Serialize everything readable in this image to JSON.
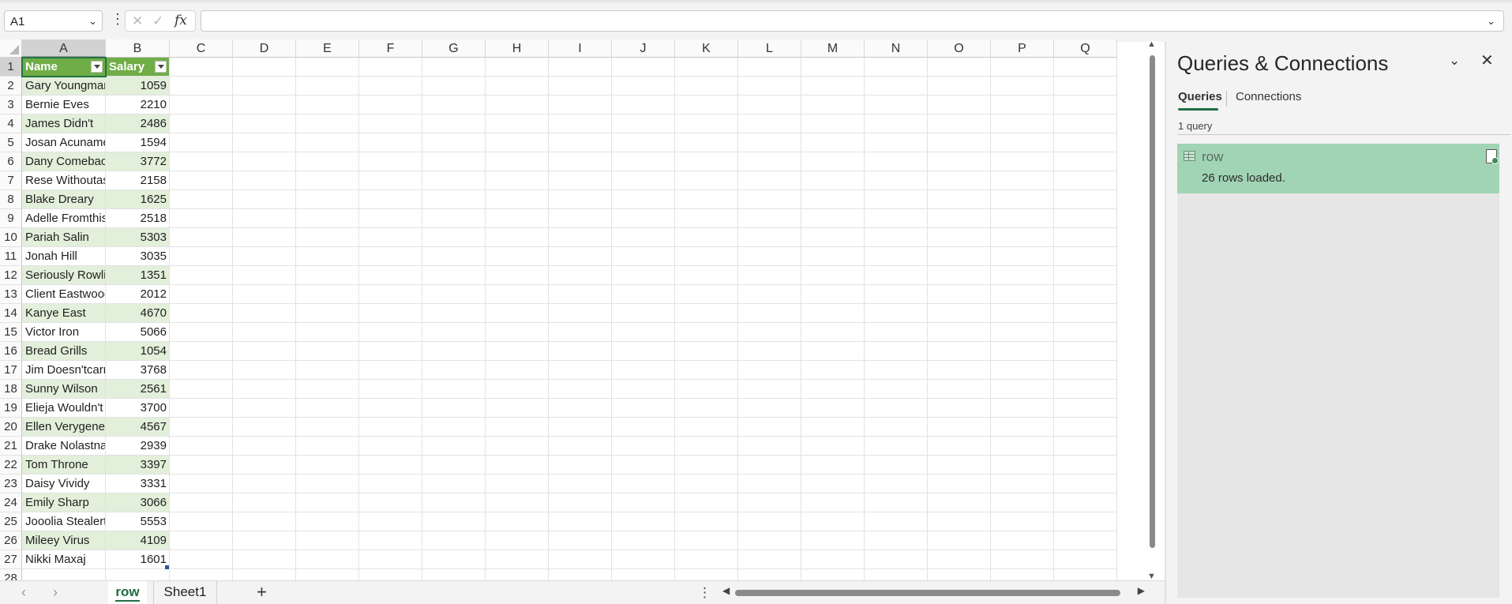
{
  "formula_bar": {
    "name_box": "A1",
    "cancel_glyph": "✕",
    "enter_glyph": "✓",
    "fx_label": "fx",
    "formula_value": "",
    "more_glyph": "⋮",
    "chevron_glyph": "⌄"
  },
  "grid": {
    "columns": [
      "A",
      "B",
      "C",
      "D",
      "E",
      "F",
      "G",
      "H",
      "I",
      "J",
      "K",
      "L",
      "M",
      "N",
      "O",
      "P",
      "Q"
    ],
    "row_numbers": [
      "1",
      "2",
      "3",
      "4",
      "5",
      "6",
      "7",
      "8",
      "9",
      "10",
      "11",
      "12",
      "13",
      "14",
      "15",
      "16",
      "17",
      "18",
      "19",
      "20",
      "21",
      "22",
      "23",
      "24",
      "25",
      "26",
      "27",
      "28"
    ],
    "table": {
      "headers": [
        "Name",
        "Salary"
      ],
      "rows": [
        [
          "Gary Youngman",
          "1059"
        ],
        [
          "Bernie Eves",
          "2210"
        ],
        [
          "James Didn't",
          "2486"
        ],
        [
          "Josan Acuname",
          "1594"
        ],
        [
          "Dany Comebackaser",
          "3772"
        ],
        [
          "Rese Withoutaspoon",
          "2158"
        ],
        [
          "Blake Dreary",
          "1625"
        ],
        [
          "Adelle Fromthisside",
          "2518"
        ],
        [
          "Pariah Salin",
          "5303"
        ],
        [
          "Jonah Hill",
          "3035"
        ],
        [
          "Seriously Rowling",
          "1351"
        ],
        [
          "Client Eastwood",
          "2012"
        ],
        [
          "Kanye East",
          "4670"
        ],
        [
          "Victor Iron",
          "5066"
        ],
        [
          "Bread Grills",
          "1054"
        ],
        [
          "Jim Doesn'tcarrey",
          "3768"
        ],
        [
          "Sunny Wilson",
          "2561"
        ],
        [
          "Elieja Wouldn't",
          "3700"
        ],
        [
          "Ellen Verygenerous",
          "4567"
        ],
        [
          "Drake Nolastname",
          "2939"
        ],
        [
          "Tom Throne",
          "3397"
        ],
        [
          "Daisy Vividy",
          "3331"
        ],
        [
          "Emily Sharp",
          "3066"
        ],
        [
          "Jooolia Stealerts",
          "5553"
        ],
        [
          "Mileey Virus",
          "4109"
        ],
        [
          "Nikki Maxaj",
          "1601"
        ]
      ]
    },
    "colors": {
      "header": "#70ad47",
      "band": "#e2efda",
      "active_border": "#217346"
    }
  },
  "sheet_tabs": {
    "tabs": [
      {
        "label": "row",
        "active": true
      },
      {
        "label": "Sheet1",
        "active": false
      }
    ],
    "prev_glyph": "‹",
    "next_glyph": "›",
    "add_glyph": "+",
    "more_glyph": "⋮"
  },
  "panel": {
    "title": "Queries & Connections",
    "collapse_glyph": "⌄",
    "close_glyph": "✕",
    "tabs": [
      "Queries",
      "Connections"
    ],
    "query_count": "1 query",
    "queries": [
      {
        "name": "row",
        "status": "26 rows loaded."
      }
    ]
  }
}
